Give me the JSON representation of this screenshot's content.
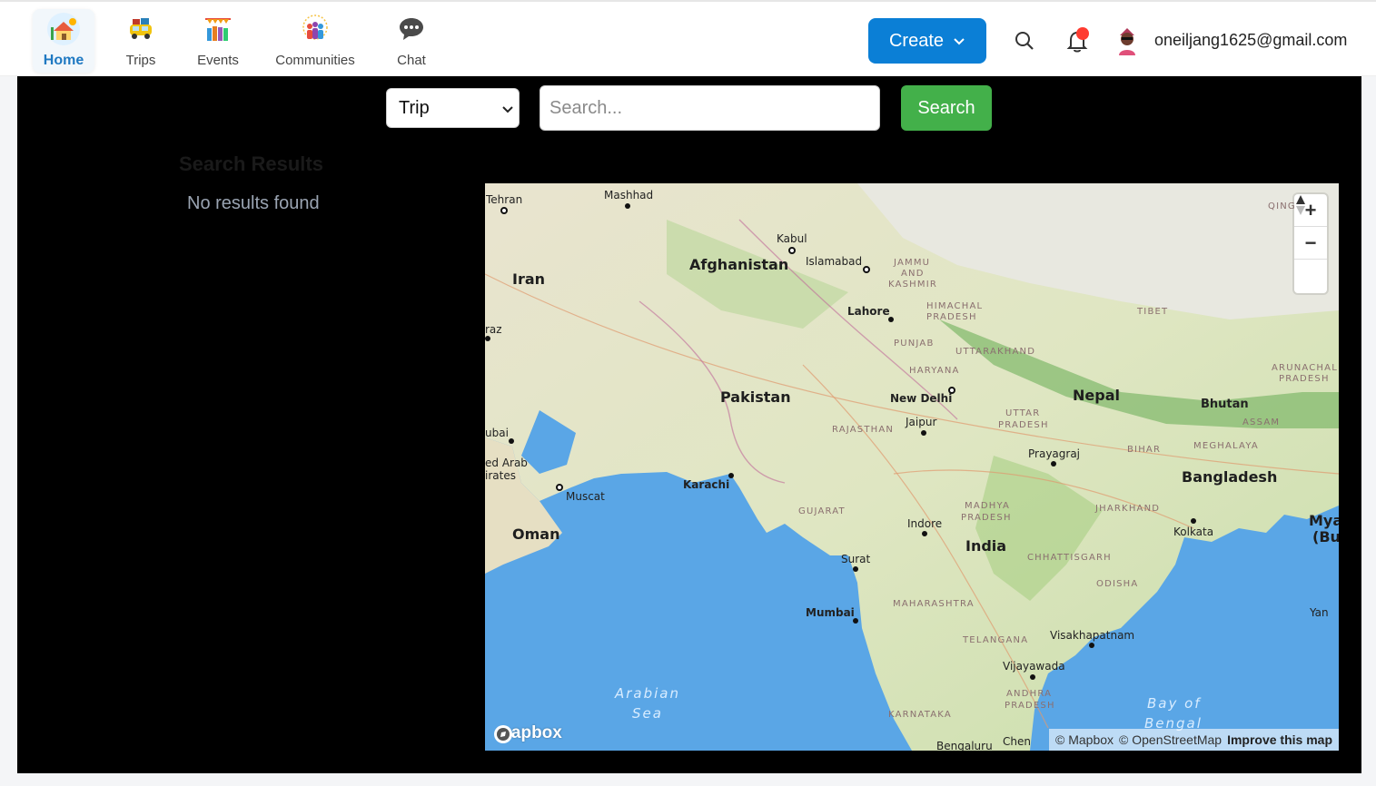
{
  "nav": {
    "items": [
      {
        "label": "Home",
        "active": true,
        "icon": "home-icon"
      },
      {
        "label": "Trips",
        "icon": "trips-icon"
      },
      {
        "label": "Events",
        "icon": "events-icon"
      },
      {
        "label": "Communities",
        "icon": "communities-icon"
      },
      {
        "label": "Chat",
        "icon": "chat-icon"
      }
    ]
  },
  "header": {
    "create_label": "Create",
    "user_email": "oneiljang1625@gmail.com"
  },
  "search": {
    "type_selected": "Trip",
    "placeholder": "Search...",
    "button_label": "Search"
  },
  "results": {
    "title": "Search Results",
    "empty_message": "No results found"
  },
  "map": {
    "countries": [
      "Afghanistan",
      "Iran",
      "Pakistan",
      "Nepal",
      "Bhutan",
      "Bangladesh",
      "India",
      "Oman",
      "Mya",
      "(Bu"
    ],
    "states": [
      "JAMMU",
      "AND",
      "KASHMIR",
      "HIMACHAL",
      "PRADESH",
      "PUNJAB",
      "UTTARAKHAND",
      "HARYANA",
      "TIBET",
      "ARUNACHAL",
      "PRADESH",
      "UTTAR",
      "PRADESH",
      "RAJASTHAN",
      "BIHAR",
      "ASSAM",
      "MEGHALAYA",
      "GUJARAT",
      "MADHYA",
      "PRADESH",
      "JHARKHAND",
      "CHHATTISGARH",
      "ODISHA",
      "MAHARASHTRA",
      "TELANGANA",
      "ANDHRA",
      "PRADESH",
      "KARNATAKA",
      "QINGHA"
    ],
    "cities": [
      "Tehran",
      "Mashhad",
      "Kabul",
      "Islamabad",
      "Lahore",
      "New Delhi",
      "Jaipur",
      "Prayagraj",
      "raz",
      "ubai",
      "ed Arab",
      "irates",
      "Muscat",
      "Karachi",
      "Indore",
      "Surat",
      "Kolkata",
      "Mumbai",
      "Visakhapatnam",
      "Vijayawada",
      "Bengaluru",
      "Chen",
      "Yan"
    ],
    "seas": [
      "Arabian",
      "Sea",
      "Bay of",
      "Bengal"
    ],
    "zoom_in": "+",
    "zoom_out": "−",
    "compass": "▲",
    "logo_text": "mapbox",
    "attribution_mapbox": "© Mapbox",
    "attribution_osm": "© OpenStreetMap",
    "attribution_improve": "Improve this map"
  },
  "colors": {
    "create_button": "#0b7fd6",
    "search_button": "#43b04a",
    "active_nav": "#1f79c2",
    "notification_dot": "#ff3b30"
  }
}
